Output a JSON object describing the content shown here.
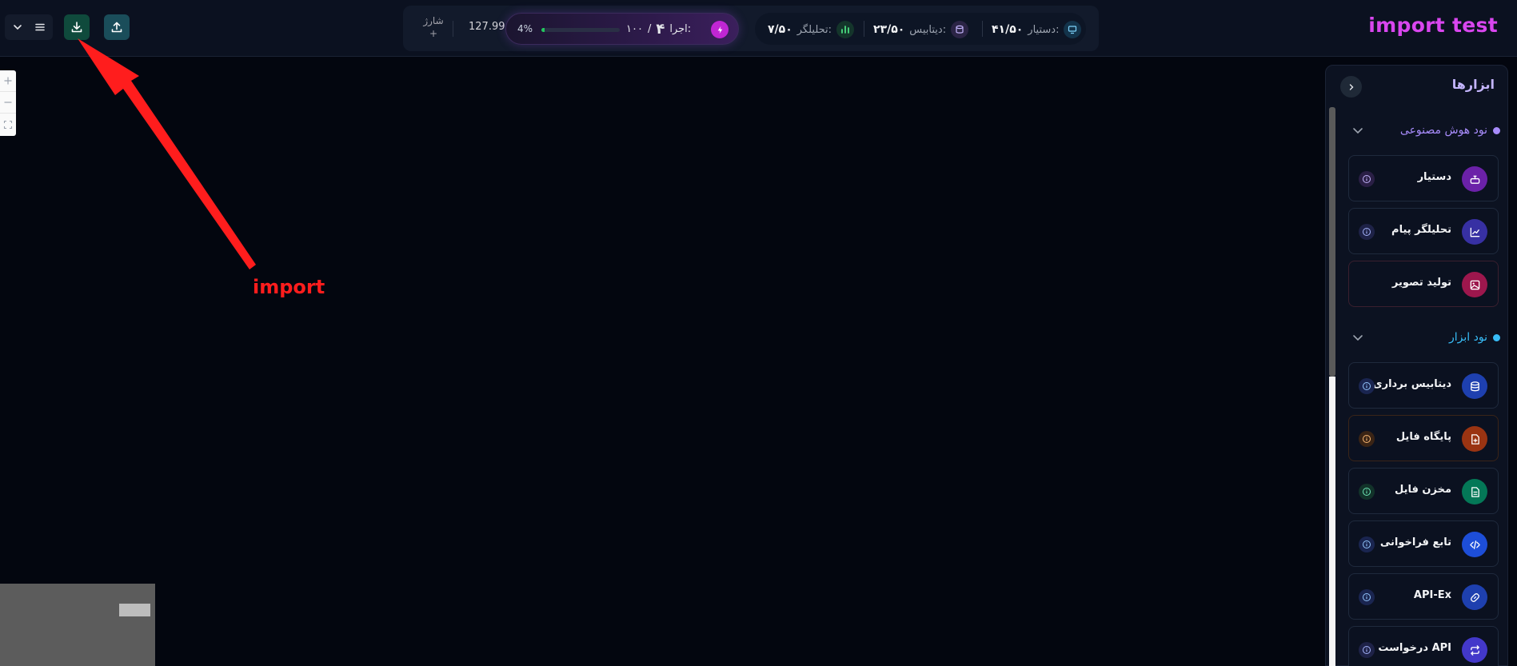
{
  "app": {
    "title": "import test"
  },
  "toolbar": {
    "charge_label": "شارژ",
    "charge_plus": "+",
    "credit": "127.99",
    "progress_pct": "4%",
    "progress_value": 0.04,
    "run_label": "اجرا:",
    "run_count": "۴",
    "run_sep": "/",
    "run_max": "۱۰۰"
  },
  "stats": {
    "analyzer_label": "تحلیلگر:",
    "analyzer_value": "۷/۵۰",
    "database_label": "دیتابیس:",
    "database_value": "۲۳/۵۰",
    "assistant_label": "دستیار:",
    "assistant_value": "۴۱/۵۰"
  },
  "annotation": {
    "label": "import",
    "color": "#ff1d1d"
  },
  "sidebar": {
    "title": "ابزارها",
    "sections": [
      {
        "label": "نود هوش مصنوعی",
        "color": "#a78bfa"
      },
      {
        "label": "نود ابزار",
        "color": "#38bdf8"
      }
    ],
    "ai_items": [
      {
        "label": "دستیار",
        "icon": "robot-icon"
      },
      {
        "label": "تحلیلگر پیام",
        "icon": "chart-icon"
      },
      {
        "label": "تولید تصویر",
        "icon": "image-icon"
      }
    ],
    "tool_items": [
      {
        "label": "دیتابیس برداری",
        "icon": "database-icon"
      },
      {
        "label": "پایگاه فایل",
        "icon": "file-plus-icon"
      },
      {
        "label": "مخزن فایل",
        "icon": "file-text-icon"
      },
      {
        "label": "تابع فراخوانی",
        "icon": "code-icon"
      },
      {
        "label": "API-Ex",
        "icon": "link-icon"
      },
      {
        "label": "درخواست API",
        "icon": "repeat-icon"
      }
    ]
  }
}
